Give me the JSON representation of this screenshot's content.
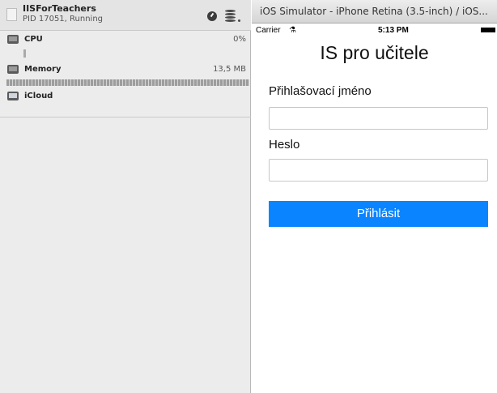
{
  "debug": {
    "process": {
      "name": "IISForTeachers",
      "status": "PID 17051, Running"
    },
    "cpu": {
      "label": "CPU",
      "value": "0%"
    },
    "memory": {
      "label": "Memory",
      "value": "13,5 MB"
    },
    "icloud": {
      "label": "iCloud"
    }
  },
  "simulator": {
    "window_title": "iOS Simulator - iPhone Retina (3.5-inch) / iOS...",
    "status_bar": {
      "carrier": "Carrier",
      "time": "5:13 PM"
    },
    "app": {
      "title": "IS pro učitele",
      "username_label": "Přihlašovací jméno",
      "password_label": "Heslo",
      "login_button": "Přihlásit"
    }
  }
}
